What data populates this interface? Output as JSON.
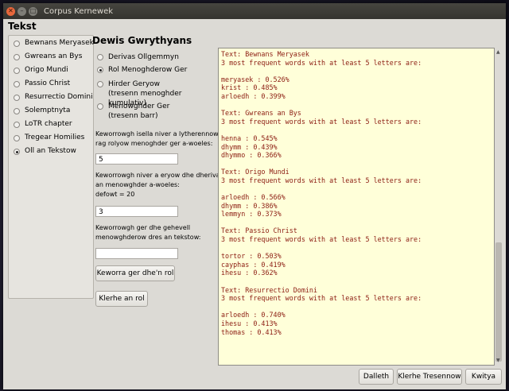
{
  "window": {
    "title": "Corpus Kernewek"
  },
  "left": {
    "heading": "Tekst",
    "items": [
      {
        "label": "Bewnans Meryasek",
        "checked": false
      },
      {
        "label": "Gwreans an Bys",
        "checked": false
      },
      {
        "label": "Origo Mundi",
        "checked": false
      },
      {
        "label": "Passio Christ",
        "checked": false
      },
      {
        "label": "Resurrectio Domini",
        "checked": false
      },
      {
        "label": "Solemptnyta",
        "checked": false
      },
      {
        "label": "LoTR chapter",
        "checked": false
      },
      {
        "label": "Tregear Homilies",
        "checked": false
      },
      {
        "label": "Oll an Tekstow",
        "checked": true
      }
    ]
  },
  "middle": {
    "heading": "Dewis Gwrythyans",
    "options": [
      {
        "label": "Derivas Ollgemmyn",
        "sub": "",
        "checked": false
      },
      {
        "label": "Rol Menoghderow Ger",
        "sub": "",
        "checked": true
      },
      {
        "label": "Hirder Geryow",
        "sub": "(tresenn menoghder kumulativ)",
        "checked": false
      },
      {
        "label": "Menowghder Ger",
        "sub": "(tresenn barr)",
        "checked": false
      }
    ],
    "prompt1": [
      "Keworrowgh isella niver a lytherennow",
      "rag rolyow menoghder ger a-woeles:"
    ],
    "field1": "5",
    "prompt2": [
      "Keworrowgh niver a eryow dhe dherivas",
      "an menowghder a-woeles:",
      "defowt = 20"
    ],
    "field2": "3",
    "prompt3": [
      "Keworrowgh ger dhe gehevell",
      "menowghderow dres an tekstow:"
    ],
    "field3": "",
    "button_compute": "Keworra ger dhe'n rol",
    "button_clear": "Klerhe an rol"
  },
  "output": {
    "lines": [
      "Text: Bewnans Meryasek",
      "3 most frequent words with at least 5 letters are:",
      "",
      "meryasek : 0.526%",
      "krist : 0.485%",
      "arloedh : 0.399%",
      "",
      "Text: Gwreans an Bys",
      "3 most frequent words with at least 5 letters are:",
      "",
      "henna : 0.545%",
      "dhymm : 0.439%",
      "dhymmo : 0.366%",
      "",
      "Text: Origo Mundi",
      "3 most frequent words with at least 5 letters are:",
      "",
      "arloedh : 0.566%",
      "dhymm : 0.386%",
      "lemmyn : 0.373%",
      "",
      "Text: Passio Christ",
      "3 most frequent words with at least 5 letters are:",
      "",
      "tortor : 0.503%",
      "cayphas : 0.419%",
      "ihesu : 0.362%",
      "",
      "Text: Resurrectio Domini",
      "3 most frequent words with at least 5 letters are:",
      "",
      "arloedh : 0.740%",
      "ihesu : 0.413%",
      "thomas : 0.413%"
    ]
  },
  "bottom_buttons": {
    "start": "Dalleth",
    "clear_output": "Klerhe Tresennow",
    "quit": "Kwitya"
  }
}
